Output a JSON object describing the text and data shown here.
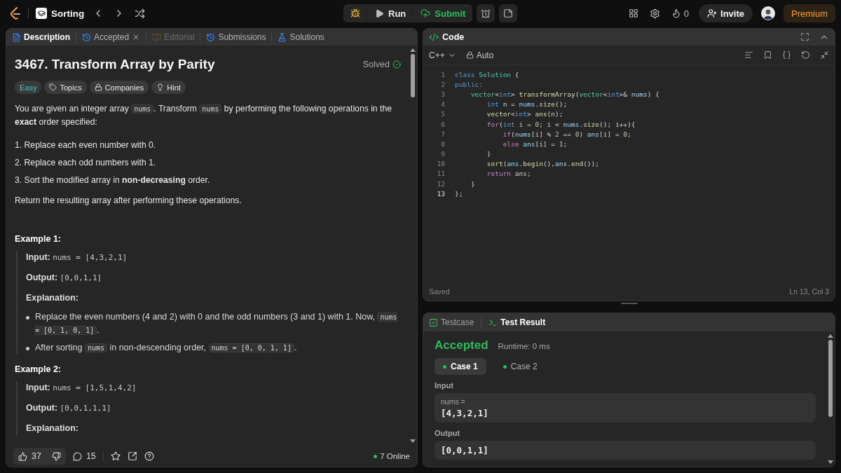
{
  "top_bar": {
    "problem_list": "Sorting",
    "run": "Run",
    "submit": "Submit",
    "streak": "0",
    "invite": "Invite",
    "premium": "Premium"
  },
  "description_panel": {
    "tabs": [
      {
        "label": "Description",
        "kind": "description",
        "selected": true,
        "disabled": false,
        "closable": false
      },
      {
        "label": "Accepted",
        "kind": "history",
        "selected": false,
        "disabled": false,
        "closable": true
      },
      {
        "label": "Editorial",
        "kind": "editorial",
        "selected": false,
        "disabled": true,
        "closable": false
      },
      {
        "label": "Submissions",
        "kind": "history",
        "selected": false,
        "disabled": false,
        "closable": false
      },
      {
        "label": "Solutions",
        "kind": "solutions",
        "selected": false,
        "disabled": false,
        "closable": false
      }
    ],
    "title": "3467. Transform Array by Parity",
    "status": "Solved",
    "tags": [
      {
        "label": "Easy",
        "kind": "difficulty"
      },
      {
        "label": "Topics",
        "kind": "topics"
      },
      {
        "label": "Companies",
        "kind": "companies"
      },
      {
        "label": "Hint",
        "kind": "hint"
      }
    ],
    "statement": [
      {
        "kind": "text",
        "text": "You are given an integer array "
      },
      {
        "kind": "code",
        "text": "nums"
      },
      {
        "kind": "text",
        "text": ". Transform "
      },
      {
        "kind": "code",
        "text": "nums"
      },
      {
        "kind": "text",
        "text": " by performing the following operations in the **exact** order specified:"
      }
    ],
    "steps": [
      "1. Replace each even number with 0.",
      "2. Replace each odd numbers with 1.",
      "3. Sort the modified array in **non-decreasing** order."
    ],
    "closing": "Return the resulting array after performing these operations.",
    "examples": [
      {
        "title": "Example 1:",
        "input_label": "Input:",
        "input": "nums = [4,3,2,1]",
        "output_label": "Output:",
        "output": "[0,0,1,1]",
        "explanation_label": "Explanation:",
        "bullets": [
          [
            {
              "kind": "text",
              "text": "Replace the even numbers (4 and 2) with 0 and the odd numbers (3 and 1) with 1. Now, "
            },
            {
              "kind": "code",
              "text": "nums = [0, 1, 0, 1]"
            },
            {
              "kind": "text",
              "text": "."
            }
          ],
          [
            {
              "kind": "text",
              "text": "After sorting "
            },
            {
              "kind": "code",
              "text": "nums"
            },
            {
              "kind": "text",
              "text": " in non-descending order, "
            },
            {
              "kind": "code",
              "text": "nums = [0, 0, 1, 1]"
            },
            {
              "kind": "text",
              "text": "."
            }
          ]
        ]
      },
      {
        "title": "Example 2:",
        "input_label": "Input:",
        "input": "nums = [1,5,1,4,2]",
        "output_label": "Output:",
        "output": "[0,0,1,1,1]",
        "explanation_label": "Explanation:"
      }
    ],
    "footer": {
      "likes": "37",
      "comments": "15",
      "online": "7 Online"
    }
  },
  "code_panel": {
    "title": "Code",
    "language": "C++",
    "mode": "Auto",
    "status": "Saved",
    "cursor": "Ln 13, Col 3",
    "lines": [
      {
        "number": "1",
        "current": false,
        "tokens": [
          {
            "kind": "keyword",
            "text": "class "
          },
          {
            "kind": "type",
            "text": "Solution"
          },
          {
            "kind": "plain",
            "text": " {"
          }
        ]
      },
      {
        "number": "2",
        "current": false,
        "tokens": [
          {
            "kind": "keyword",
            "text": "public:"
          }
        ]
      },
      {
        "number": "3",
        "current": false,
        "tokens": [
          {
            "kind": "type",
            "text": "    vector"
          },
          {
            "kind": "plain",
            "text": "<"
          },
          {
            "kind": "keyword",
            "text": "int"
          },
          {
            "kind": "plain",
            "text": "> "
          },
          {
            "kind": "func",
            "text": "transformArray"
          },
          {
            "kind": "plain",
            "text": "("
          },
          {
            "kind": "type",
            "text": "vector"
          },
          {
            "kind": "plain",
            "text": "<"
          },
          {
            "kind": "keyword",
            "text": "int"
          },
          {
            "kind": "plain",
            "text": ">& "
          },
          {
            "kind": "var",
            "text": "nums"
          },
          {
            "kind": "plain",
            "text": ") {"
          }
        ]
      },
      {
        "number": "4",
        "current": false,
        "tokens": [
          {
            "kind": "keyword",
            "text": "        int"
          },
          {
            "kind": "plain",
            "text": " n = "
          },
          {
            "kind": "var",
            "text": "nums"
          },
          {
            "kind": "plain",
            "text": "."
          },
          {
            "kind": "func",
            "text": "size"
          },
          {
            "kind": "plain",
            "text": "();"
          }
        ]
      },
      {
        "number": "5",
        "current": false,
        "tokens": [
          {
            "kind": "func",
            "text": "        vector"
          },
          {
            "kind": "plain",
            "text": "<"
          },
          {
            "kind": "keyword",
            "text": "int"
          },
          {
            "kind": "plain",
            "text": "> "
          },
          {
            "kind": "func",
            "text": "ans"
          },
          {
            "kind": "plain",
            "text": "(n);"
          }
        ]
      },
      {
        "number": "6",
        "current": false,
        "tokens": [
          {
            "kind": "control",
            "text": "        for"
          },
          {
            "kind": "plain",
            "text": "("
          },
          {
            "kind": "keyword",
            "text": "int"
          },
          {
            "kind": "plain",
            "text": " i = "
          },
          {
            "kind": "number",
            "text": "0"
          },
          {
            "kind": "plain",
            "text": "; i < "
          },
          {
            "kind": "var",
            "text": "nums"
          },
          {
            "kind": "plain",
            "text": "."
          },
          {
            "kind": "func",
            "text": "size"
          },
          {
            "kind": "plain",
            "text": "(); i++){"
          }
        ]
      },
      {
        "number": "7",
        "current": false,
        "tokens": [
          {
            "kind": "control",
            "text": "            if"
          },
          {
            "kind": "plain",
            "text": "("
          },
          {
            "kind": "var",
            "text": "nums"
          },
          {
            "kind": "plain",
            "text": "[i] % "
          },
          {
            "kind": "number",
            "text": "2"
          },
          {
            "kind": "plain",
            "text": " == "
          },
          {
            "kind": "number",
            "text": "0"
          },
          {
            "kind": "plain",
            "text": ") "
          },
          {
            "kind": "var",
            "text": "ans"
          },
          {
            "kind": "plain",
            "text": "[i] = "
          },
          {
            "kind": "number",
            "text": "0"
          },
          {
            "kind": "plain",
            "text": ";"
          }
        ]
      },
      {
        "number": "8",
        "current": false,
        "tokens": [
          {
            "kind": "control",
            "text": "            else "
          },
          {
            "kind": "var",
            "text": "ans"
          },
          {
            "kind": "plain",
            "text": "[i] = "
          },
          {
            "kind": "number",
            "text": "1"
          },
          {
            "kind": "plain",
            "text": ";"
          }
        ]
      },
      {
        "number": "9",
        "current": false,
        "tokens": [
          {
            "kind": "plain",
            "text": "        }"
          }
        ]
      },
      {
        "number": "10",
        "current": false,
        "tokens": [
          {
            "kind": "func",
            "text": "        sort"
          },
          {
            "kind": "plain",
            "text": "("
          },
          {
            "kind": "var",
            "text": "ans"
          },
          {
            "kind": "plain",
            "text": "."
          },
          {
            "kind": "func",
            "text": "begin"
          },
          {
            "kind": "plain",
            "text": "(),"
          },
          {
            "kind": "var",
            "text": "ans"
          },
          {
            "kind": "plain",
            "text": "."
          },
          {
            "kind": "func",
            "text": "end"
          },
          {
            "kind": "plain",
            "text": "());"
          }
        ]
      },
      {
        "number": "11",
        "current": false,
        "tokens": [
          {
            "kind": "control",
            "text": "        return"
          },
          {
            "kind": "plain",
            "text": " ans;"
          }
        ]
      },
      {
        "number": "12",
        "current": false,
        "tokens": [
          {
            "kind": "plain",
            "text": "    }"
          }
        ]
      },
      {
        "number": "13",
        "current": true,
        "tokens": [
          {
            "kind": "plain",
            "text": "};"
          }
        ]
      }
    ]
  },
  "test_panel": {
    "tabs": [
      {
        "label": "Testcase",
        "kind": "testcase",
        "selected": false
      },
      {
        "label": "Test Result",
        "kind": "result",
        "selected": true
      }
    ],
    "verdict": "Accepted",
    "runtime": "Runtime: 0 ms",
    "cases": [
      {
        "label": "Case 1",
        "selected": true,
        "passed": true
      },
      {
        "label": "Case 2",
        "selected": false,
        "passed": true
      }
    ],
    "input_label": "Input",
    "input_name": "nums =",
    "input_value": "[4,3,2,1]",
    "output_label": "Output",
    "output_value": "[0,0,1,1]"
  }
}
